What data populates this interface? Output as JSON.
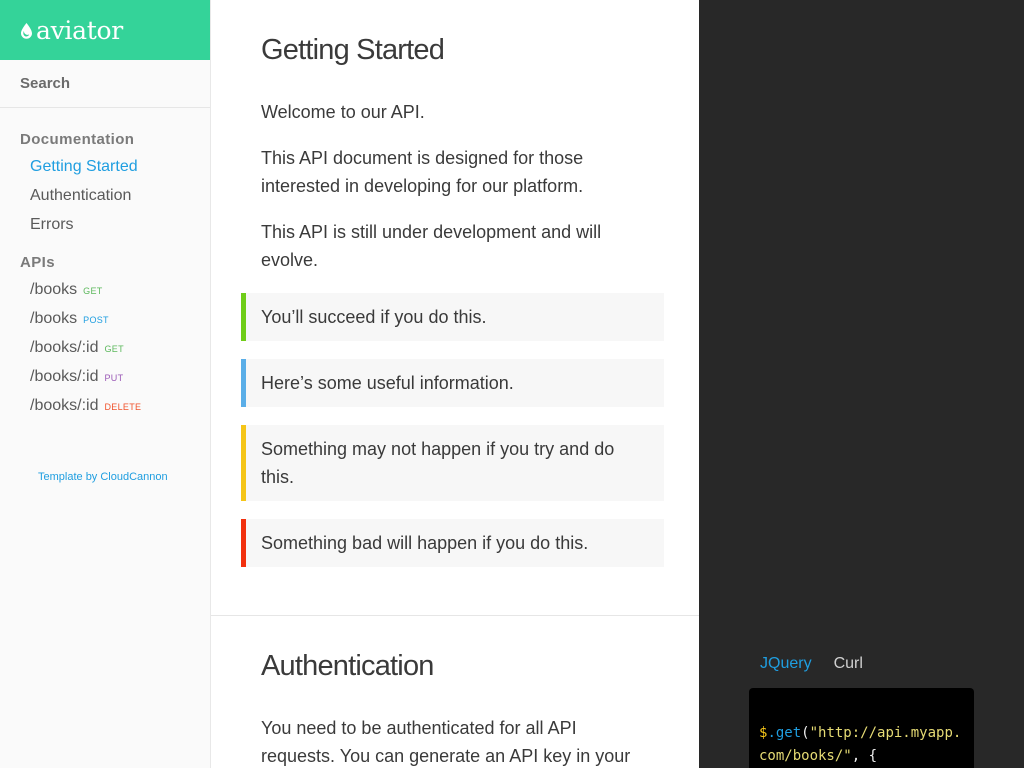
{
  "logo": {
    "text": "aviator"
  },
  "search": {
    "label": "Search"
  },
  "nav": {
    "documentation_heading": "Documentation",
    "documentation_items": [
      "Getting Started",
      "Authentication",
      "Errors"
    ],
    "apis_heading": "APIs",
    "api_items": [
      {
        "path": "/books",
        "method": "GET"
      },
      {
        "path": "/books",
        "method": "POST"
      },
      {
        "path": "/books/:id",
        "method": "GET"
      },
      {
        "path": "/books/:id",
        "method": "PUT"
      },
      {
        "path": "/books/:id",
        "method": "DELETE"
      }
    ],
    "credit": "Template by CloudCannon"
  },
  "getting_started": {
    "title": "Getting Started",
    "paragraphs": [
      "Welcome to our API.",
      "This API document is designed for those interested in developing for our platform.",
      "This API is still under development and will evolve."
    ],
    "callouts": {
      "success": "You’ll succeed if you do this.",
      "info": "Here’s some useful information.",
      "warning": "Something may not happen if you try and do this.",
      "danger": "Something bad will happen if you do this."
    }
  },
  "authentication": {
    "title": "Authentication",
    "paragraph": "You need to be authenticated for all API requests. You can generate an API key in your"
  },
  "code_panel": {
    "tabs": [
      "JQuery",
      "Curl"
    ],
    "code_dollar": "$",
    "code_fn": ".get",
    "code_open": "(",
    "code_string": "\"http://api.myapp.com/books/\"",
    "code_rest": ", {"
  },
  "colors": {
    "brand": "#34d399",
    "link": "#1f9ee0",
    "get": "#5cb85c",
    "post": "#1f9ee0",
    "put": "#9b59b6",
    "delete": "#f0522b",
    "success": "#6fcd18",
    "info": "#5aaee8",
    "warning": "#f5c518",
    "danger": "#f2300e"
  }
}
